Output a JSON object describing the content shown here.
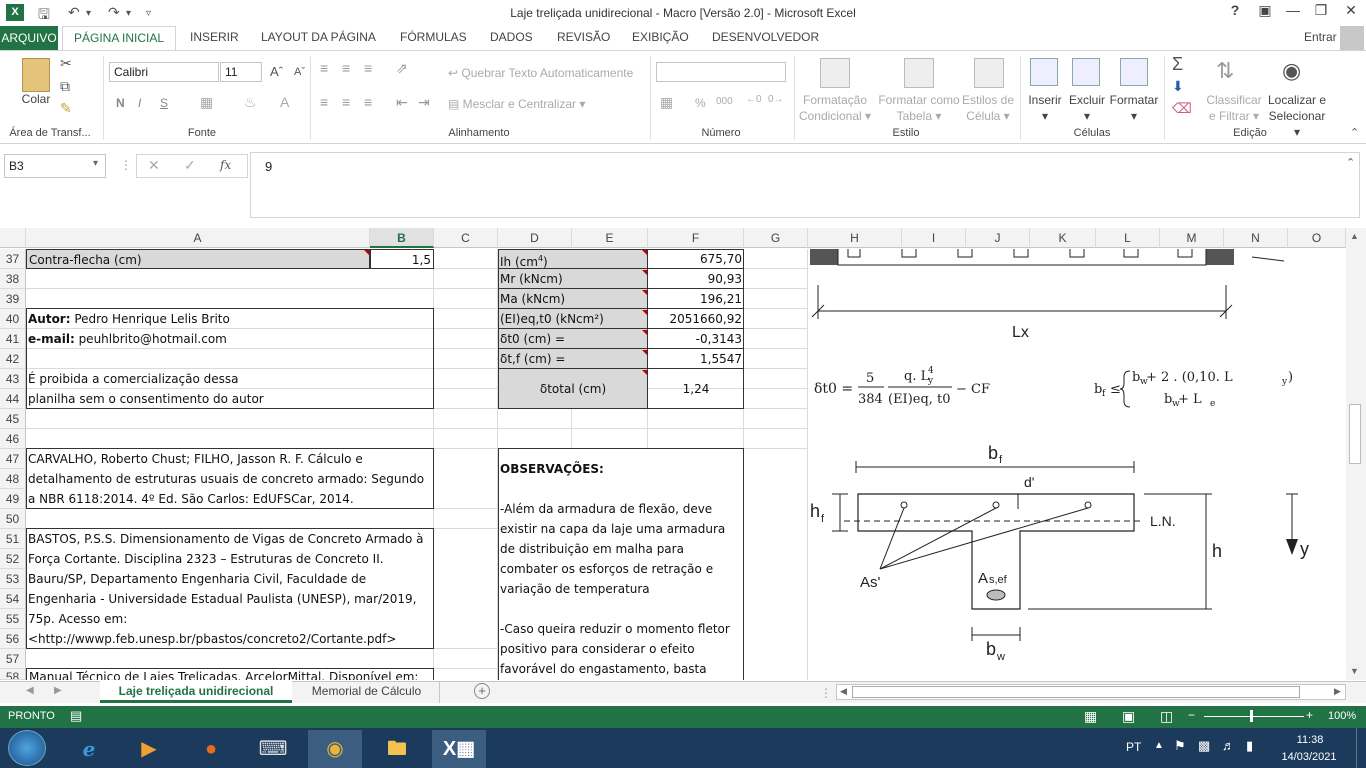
{
  "window": {
    "title": "Laje treliçada unidirecional - Macro [Versão 2.0] - Microsoft Excel",
    "logo": "X",
    "help": "?",
    "user": "Entrar"
  },
  "tabs": {
    "file": "ARQUIVO",
    "home": "PÁGINA INICIAL",
    "insert": "INSERIR",
    "layout": "LAYOUT DA PÁGINA",
    "formulas": "FÓRMULAS",
    "data": "DADOS",
    "review": "REVISÃO",
    "view": "EXIBIÇÃO",
    "developer": "DESENVOLVEDOR"
  },
  "ribbon": {
    "paste": "Colar",
    "font_name": "Calibri",
    "font_size": "11",
    "bold": "N",
    "italic": "I",
    "underline": "S",
    "wrap_text": "Quebrar Texto Automaticamente",
    "merge_center": "Mesclar e Centralizar",
    "percent": "%",
    "thousands": "000",
    "cond_format_1": "Formatação",
    "cond_format_2": "Condicional",
    "format_table_1": "Formatar como",
    "format_table_2": "Tabela",
    "cell_styles_1": "Estilos de",
    "cell_styles_2": "Célula",
    "insert": "Inserir",
    "delete": "Excluir",
    "format": "Formatar",
    "sort_1": "Classificar",
    "sort_2": "e Filtrar",
    "find_1": "Localizar e",
    "find_2": "Selecionar",
    "groups": {
      "clipboard": "Área de Transf...",
      "font": "Fonte",
      "alignment": "Alinhamento",
      "number": "Número",
      "styles": "Estilo",
      "cells": "Células",
      "editing": "Edição"
    }
  },
  "formula_bar": {
    "name_box": "B3",
    "fx": "fx",
    "value": "9"
  },
  "columns": [
    "A",
    "B",
    "C",
    "D",
    "E",
    "F",
    "G",
    "H",
    "I",
    "J",
    "K",
    "L",
    "M",
    "N",
    "O"
  ],
  "rows": [
    "37",
    "38",
    "39",
    "40",
    "41",
    "42",
    "43",
    "44",
    "45",
    "46",
    "47",
    "48",
    "49",
    "50",
    "51",
    "52",
    "53",
    "54",
    "55",
    "56",
    "57",
    "58"
  ],
  "cells": {
    "a37": "Contra-flecha (cm)",
    "b37": "1,5",
    "a40_bold": "Autor:",
    "a40": " Pedro Henrique Lelis Brito",
    "a41_bold": "e-mail:",
    "a41": " peuhlbrito@hotmail.com",
    "a43": "É proibida a comercialização dessa",
    "a44": "planilha sem o consentimento do autor",
    "a47": "CARVALHO, Roberto Chust; FILHO, Jasson R. F. Cálculo e",
    "a48": "detalhamento de estruturas usuais de concreto armado: Segundo",
    "a49": "a NBR 6118:2014. 4º Ed. São Carlos: EdUFSCar, 2014.",
    "a51": "BASTOS, P.S.S. Dimensionamento de Vigas de Concreto Armado à",
    "a52": "Força Cortante. Disciplina 2323 – Estruturas de Concreto II.",
    "a53": "Bauru/SP, Departamento Engenharia Civil, Faculdade de",
    "a54": "Engenharia - Universidade Estadual Paulista (UNESP), mar/2019,",
    "a55": "75p. Acesso em:",
    "a56": "<http://wwwp.feb.unesp.br/pbastos/concreto2/Cortante.pdf>",
    "a58": "Manual Técnico de Lajes Treliçadas. ArcelorMittal. Disponível em:",
    "d37": "Ih (cm",
    "d37_sup": "4",
    "d37_end": ")",
    "f37": "675,70",
    "d38": "Mr (kNcm)",
    "f38": "90,93",
    "d39": "Ma (kNcm)",
    "f39": "196,21",
    "d40": "(EI)eq,t0 (kNcm²)",
    "f40": "2051660,92",
    "d41": "δt0 (cm) =",
    "f41": "-0,3143",
    "d42": "δt,f (cm) =",
    "f42": "1,5547",
    "d43": "δtotal (cm)",
    "f43": "1,24",
    "obs_title": "OBSERVAÇÕES:",
    "obs_1": "-Além da armadura de flexão, deve",
    "obs_2": "existir na capa da laje uma armadura",
    "obs_3": "de distribuição em malha para",
    "obs_4": "combater os esforços de retração e",
    "obs_5": "variação de temperatura",
    "obs_6": "-Caso queira reduzir o momento fletor",
    "obs_7": "positivo para considerar o efeito",
    "obs_8": "favorável do engastamento, basta"
  },
  "drawing": {
    "lx": "Lx",
    "formula_left": "δt0 =",
    "num5": "5",
    "den384": "384",
    "q_lx4": "q. L",
    "q_lx4_sup": "4",
    "q_lx4_sub": "y",
    "den_ei": "(EI)eq, t0",
    "minus_cf": "− CF",
    "bf_le": "b",
    "bf_sub": "f",
    "le": "≤",
    "brace_1": "b",
    "brace_1_sub": "w",
    "brace_1_rest": " + 2 . (0,10. L",
    "brace_1_sub2": "y",
    "brace_1_end": ")",
    "brace_2": "b",
    "brace_2_sub": "w",
    "brace_2_rest": " + L",
    "brace_2_sub2": "e",
    "bf": "b",
    "bf_s": "f",
    "dprime": "d'",
    "hf": "h",
    "hf_s": "f",
    "ln": "L.N.",
    "h": "h",
    "y": "y",
    "as_prime": "As'",
    "asef": "A",
    "asef_sub": "s,ef",
    "bw": "b",
    "bw_s": "w"
  },
  "sheets": {
    "active": "Laje treliçada unidirecional",
    "other": "Memorial de Cálculo"
  },
  "status": {
    "ready": "PRONTO",
    "zoom": "100%"
  },
  "taskbar": {
    "lang": "PT",
    "time": "11:38",
    "date": "14/03/2021"
  },
  "colors": {
    "excel_green": "#217346",
    "taskbar": "#1c3a5c"
  }
}
